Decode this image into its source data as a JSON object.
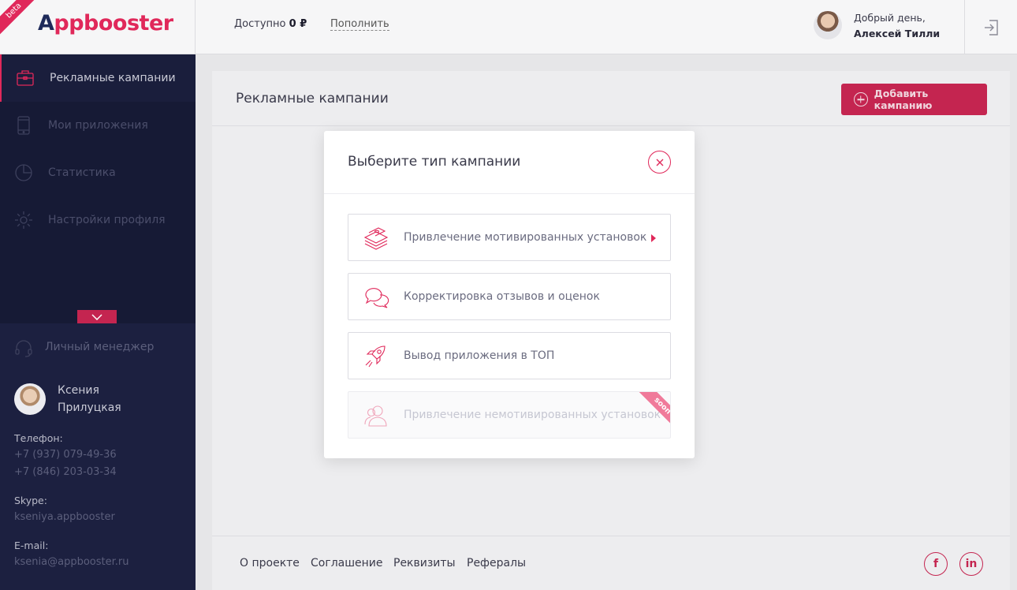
{
  "header": {
    "beta_label": "beta",
    "logo_letter": "A",
    "logo_rest": "ppbooster",
    "balance_label": "Доступно",
    "balance_value": "0 ₽",
    "topup_link": "Пополнить",
    "greeting": "Добрый день,",
    "user_name": "Алексей Тилли"
  },
  "sidebar": {
    "items": [
      {
        "label": "Рекламные кампании",
        "icon": "briefcase-icon",
        "active": true
      },
      {
        "label": "Мои приложения",
        "icon": "phone-icon",
        "active": false
      },
      {
        "label": "Статистика",
        "icon": "pie-chart-icon",
        "active": false
      },
      {
        "label": "Настройки профиля",
        "icon": "gear-icon",
        "active": false
      }
    ],
    "manager": {
      "title": "Личный менеджер",
      "first_name": "Ксения",
      "last_name": "Прилуцкая",
      "phone_label": "Телефон:",
      "phone_1": "+7 (937) 079-49-36",
      "phone_2": "+7 (846) 203-03-34",
      "skype_label": "Skype:",
      "skype": "kseniya.appbooster",
      "email_label": "E-mail:",
      "email": "ksenia@appbooster.ru"
    }
  },
  "main": {
    "title": "Рекламные кампании",
    "add_button": "Добавить кампанию",
    "footer_links": [
      "О проекте",
      "Соглашение",
      "Реквизиты",
      "Рефералы"
    ],
    "social": {
      "facebook": "f",
      "linkedin": "in"
    }
  },
  "modal": {
    "title": "Выберите тип кампании",
    "options": [
      {
        "label": "Привлечение мотивированных установок",
        "icon": "money-stack-icon",
        "enabled": true
      },
      {
        "label": "Корректировка отзывов и оценок",
        "icon": "chat-bubbles-icon",
        "enabled": true
      },
      {
        "label": "Вывод приложения в ТОП",
        "icon": "rocket-icon",
        "enabled": true
      },
      {
        "label": "Привлечение немотивированных установок",
        "icon": "users-icon",
        "enabled": false,
        "badge": "soon"
      }
    ]
  },
  "colors": {
    "accent": "#e0285a",
    "sidebar_bg": "#161a35",
    "logo_dark": "#1e2a5a"
  }
}
